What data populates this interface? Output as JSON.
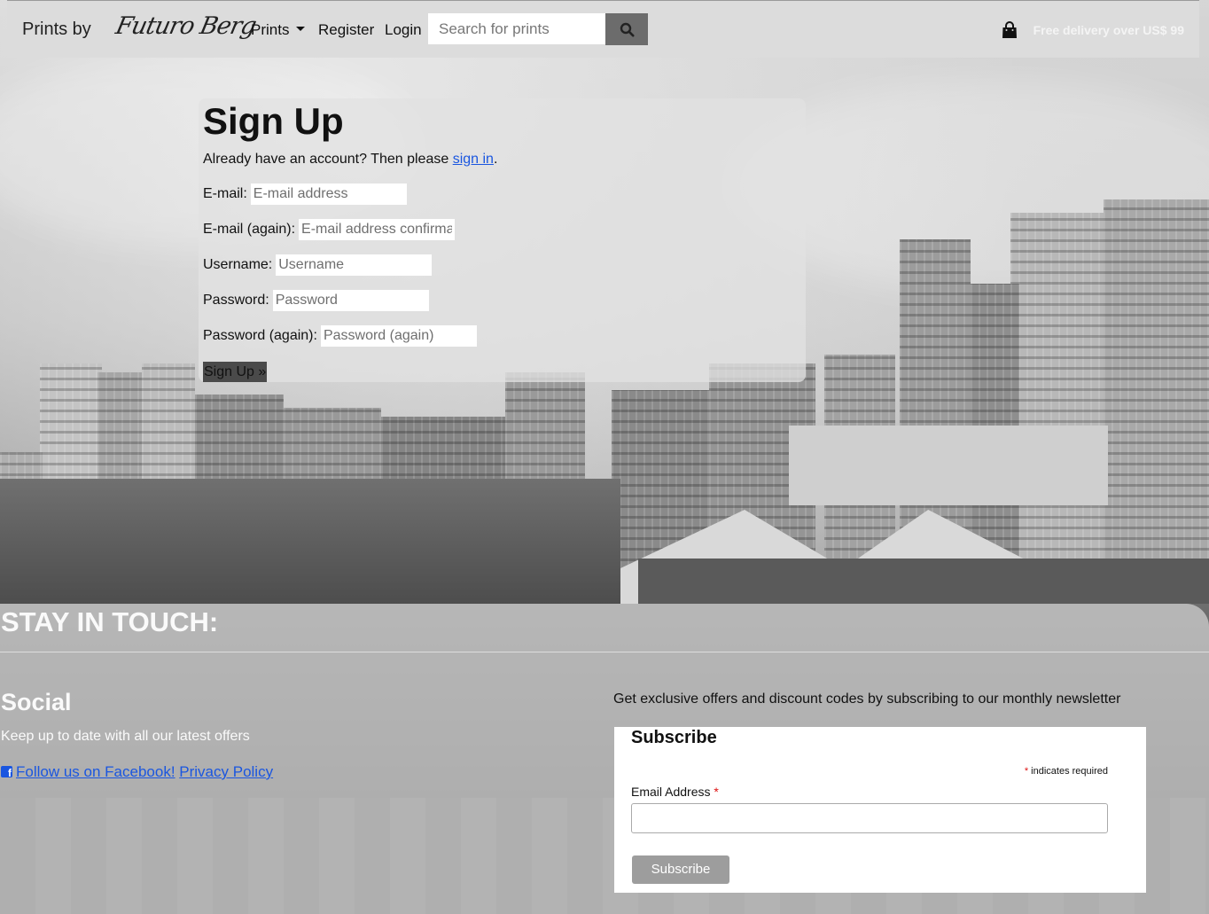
{
  "navbar": {
    "brand_text": "Prints by",
    "brand_logo": "Futuro Berg",
    "links": [
      {
        "label": "Prints",
        "has_dropdown": true
      },
      {
        "label": "Register"
      },
      {
        "label": "Login"
      }
    ],
    "search": {
      "placeholder": "Search for prints",
      "button_icon": "search-icon"
    },
    "cart_icon": "shopping-bag-icon",
    "delivery_text": "Free delivery over US$ 99"
  },
  "signup": {
    "title": "Sign Up",
    "account_prompt": "Already have an account? Then please ",
    "sign_in_link": "sign in",
    "prompt_end": ".",
    "fields": [
      {
        "label": "E-mail:",
        "placeholder": "E-mail address"
      },
      {
        "label": "E-mail (again):",
        "placeholder": "E-mail address confirmation"
      },
      {
        "label": "Username:",
        "placeholder": "Username"
      },
      {
        "label": "Password:",
        "placeholder": "Password"
      },
      {
        "label": "Password (again):",
        "placeholder": "Password (again)"
      }
    ],
    "submit_label": "Sign Up »"
  },
  "footer": {
    "heading": "STAY IN TOUCH:",
    "social": {
      "title": "Social",
      "subtitle": "Keep up to date with all our latest offers",
      "facebook_link": "Follow us on Facebook!",
      "privacy_link": "Privacy Policy"
    },
    "newsletter": {
      "blurb": "Get exclusive offers and discount codes by subscribing to our monthly newsletter",
      "title": "Subscribe",
      "required_note": "indicates required",
      "email_label": "Email Address",
      "button_label": "Subscribe"
    }
  },
  "colors": {
    "navbar_bg": "#dcdcdc",
    "link": "#1a56e0",
    "required_star": "#dd1111",
    "search_button": "#6c6c6c",
    "subscribe_button": "#9d9d9d"
  }
}
